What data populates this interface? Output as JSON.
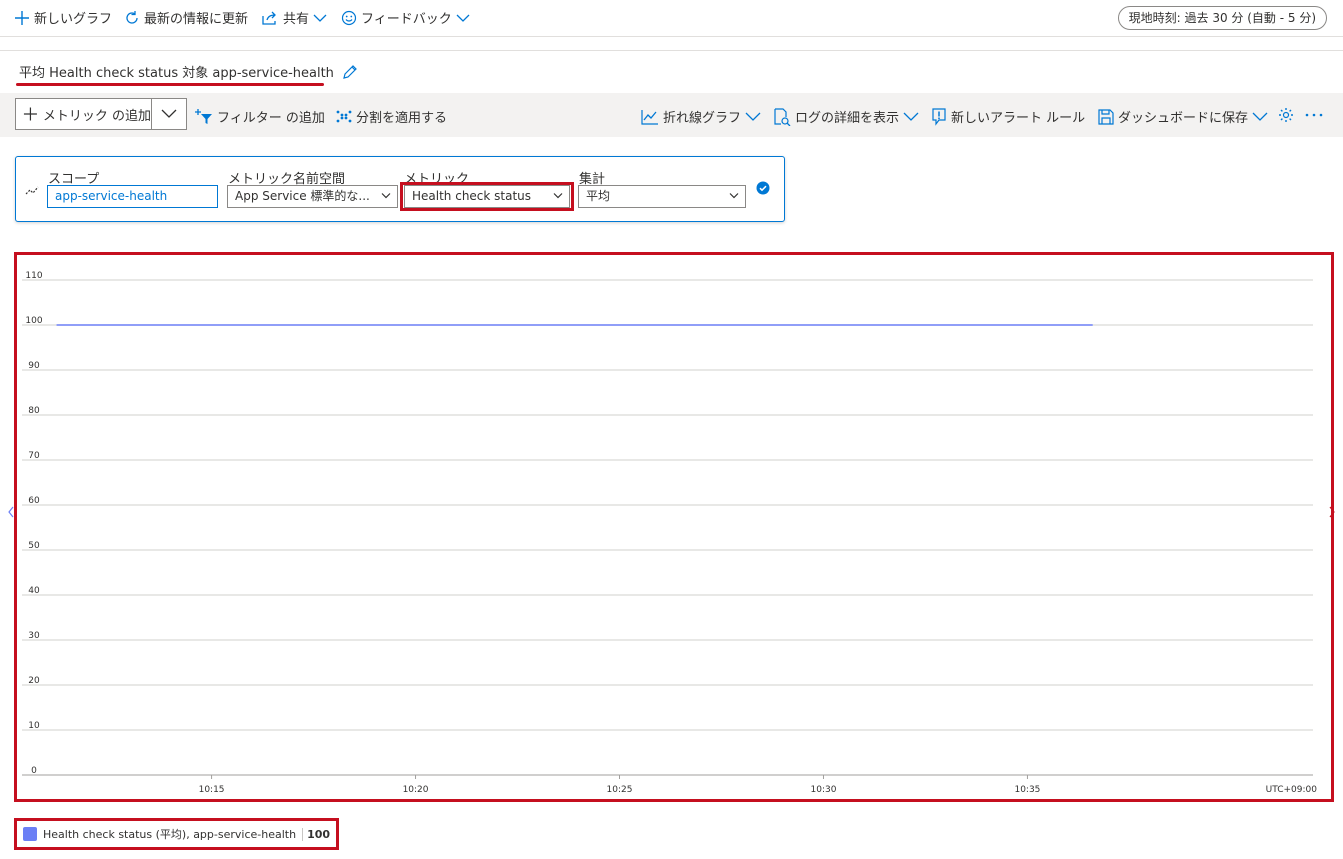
{
  "topbar": {
    "new_chart": "新しいグラフ",
    "refresh": "最新の情報に更新",
    "share": "共有",
    "feedback": "フィードバック",
    "time_range": "現地時刻: 過去 30 分 (自動 - 5 分)"
  },
  "chart_title": "平均 Health check status 対象 app-service-health",
  "toolbar": {
    "add_metric": "メトリック の追加",
    "add_filter": "フィルター の追加",
    "apply_split": "分割を適用する",
    "line_chart": "折れ線グラフ",
    "view_logs": "ログの詳細を表示",
    "new_alert": "新しいアラート ルール",
    "save_dashboard": "ダッシュボードに保存"
  },
  "selector": {
    "scope_label": "スコープ",
    "scope_value": "app-service-health",
    "namespace_label": "メトリック名前空間",
    "namespace_value": "App Service 標準的な...",
    "metric_label": "メトリック",
    "metric_value": "Health check status",
    "aggregation_label": "集計",
    "aggregation_value": "平均"
  },
  "chart_data": {
    "type": "line",
    "y_ticks": [
      "0",
      "10",
      "20",
      "30",
      "40",
      "50",
      "60",
      "70",
      "80",
      "90",
      "100",
      "110"
    ],
    "ylim": [
      0,
      110
    ],
    "x_ticks": [
      "10:15",
      "10:20",
      "10:25",
      "10:30",
      "10:35"
    ],
    "xlim_minutes": [
      10.5,
      42.0
    ],
    "x_tick_minutes": [
      15,
      20,
      25,
      30,
      35
    ],
    "timezone": "UTC+09:00",
    "series": [
      {
        "name": "Health check status (平均), app-service-health",
        "color": "#6b7ff5",
        "x_minutes": [
          11.2,
          36.6
        ],
        "values": [
          100,
          100
        ]
      }
    ],
    "grid": true
  },
  "legend": {
    "label": "Health check status (平均), app-service-health",
    "value": "100"
  }
}
